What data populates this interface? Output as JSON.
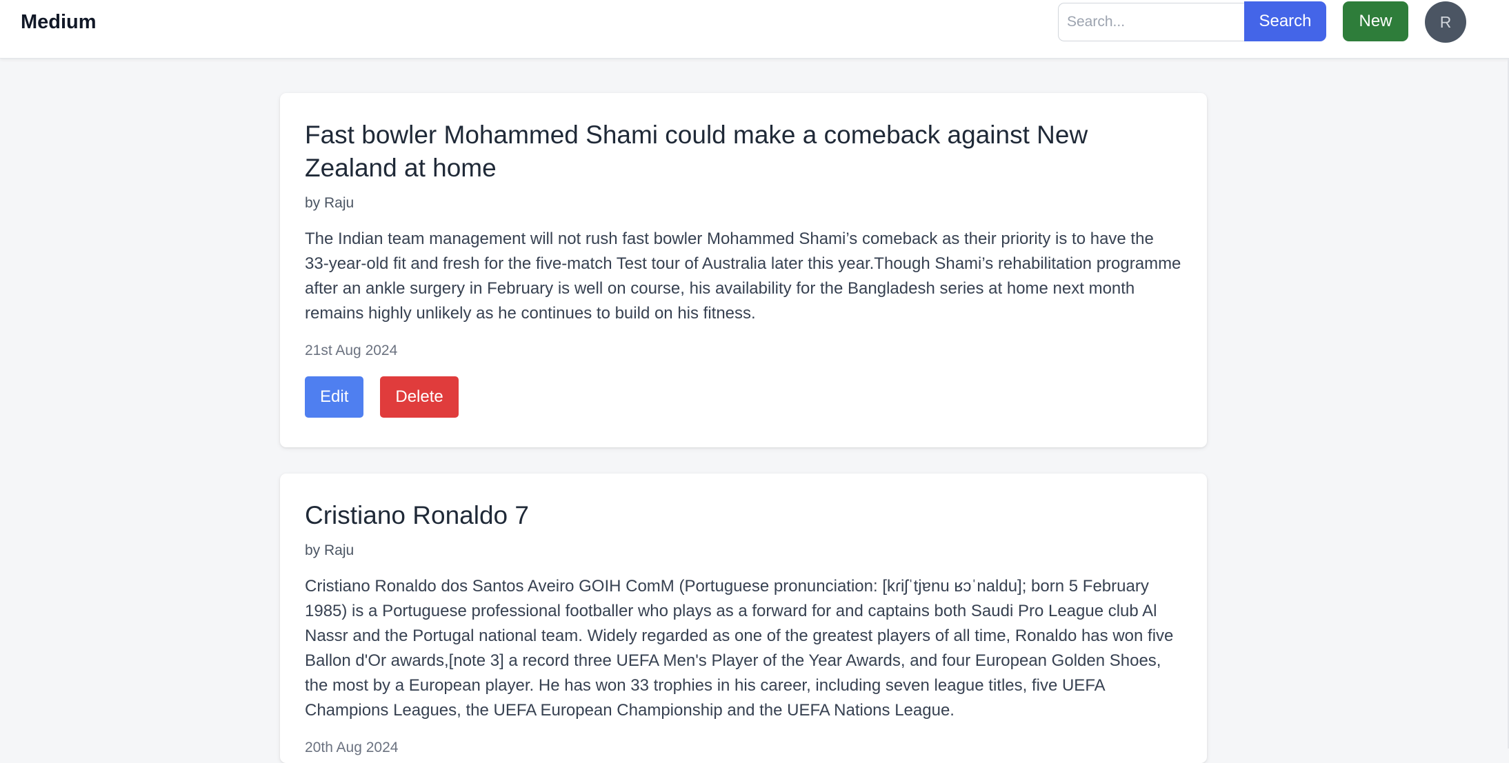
{
  "app": {
    "brand": "Medium"
  },
  "header": {
    "search_placeholder": "Search...",
    "search_label": "Search",
    "new_label": "New",
    "avatar_initial": "R"
  },
  "posts": [
    {
      "title": "Fast bowler Mohammed Shami could make a comeback against New Zealand at home",
      "author": "by Raju",
      "body": "The Indian team management will not rush fast bowler Mohammed Shami’s comeback as their priority is to have the 33-year-old fit and fresh for the five-match Test tour of Australia later this year.Though Shami’s rehabilitation programme after an ankle surgery in February is well on course, his availability for the Bangladesh series at home next month remains highly unlikely as he continues to build on his fitness.",
      "date": "21st Aug 2024",
      "edit_label": "Edit",
      "delete_label": "Delete"
    },
    {
      "title": "Cristiano Ronaldo 7",
      "author": "by Raju",
      "body": "Cristiano Ronaldo dos Santos Aveiro GOIH ComM (Portuguese pronunciation: [kɾiʃˈtjɐnu ʁɔˈnaldu]; born 5 February 1985) is a Portuguese professional footballer who plays as a forward for and captains both Saudi Pro League club Al Nassr and the Portugal national team. Widely regarded as one of the greatest players of all time, Ronaldo has won five Ballon d'Or awards,[note 3] a record three UEFA Men's Player of the Year Awards, and four European Golden Shoes, the most by a European player. He has won 33 trophies in his career, including seven league titles, five UEFA Champions Leagues, the UEFA European Championship and the UEFA Nations League.",
      "date": "20th Aug 2024"
    }
  ],
  "colors": {
    "search_button": "#4465e8",
    "new_button": "#2e7d3a",
    "edit_button": "#4f7ff0",
    "delete_button": "#e03c3c",
    "avatar": "#4b5563"
  }
}
